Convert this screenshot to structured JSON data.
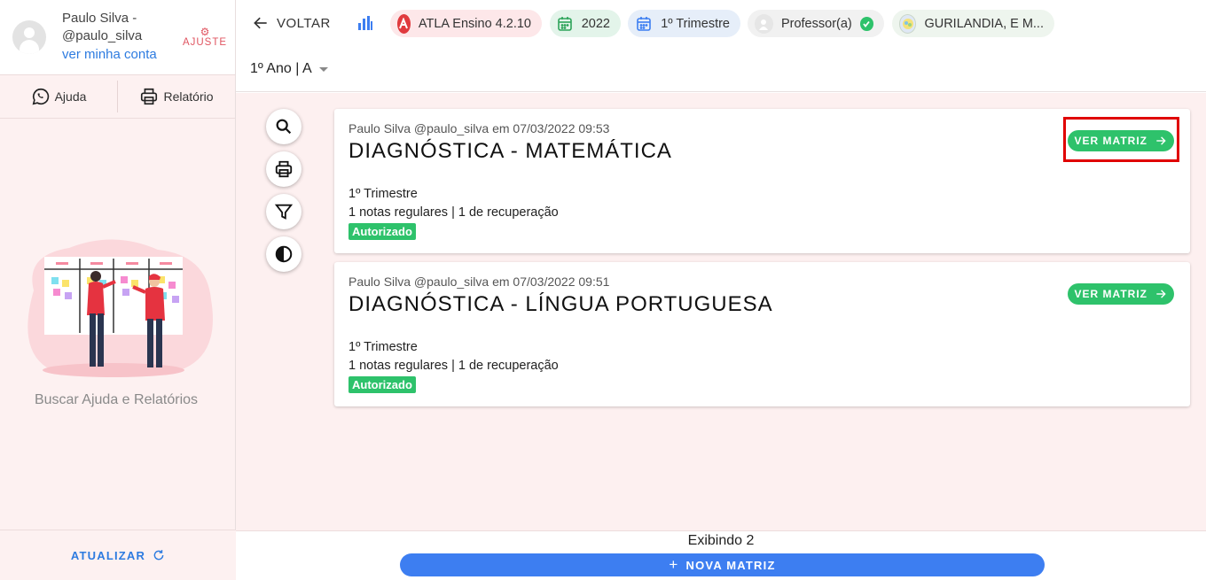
{
  "sidebar": {
    "profile": {
      "name": "Paulo Silva - @paulo_silva",
      "link": "ver minha conta",
      "ajuste_label": "AJUSTE"
    },
    "buttons": [
      {
        "label": "Ajuda",
        "icon": "whatsapp-icon"
      },
      {
        "label": "Relatório",
        "icon": "printer-icon"
      }
    ],
    "help_text": "Buscar Ajuda e Relatórios",
    "footer": {
      "label": "ATUALIZAR",
      "icon": "refresh-icon"
    }
  },
  "topbar": {
    "back_label": "VOLTAR",
    "chips": {
      "app": "ATLA Ensino 4.2.10",
      "year": "2022",
      "term": "1º Trimestre",
      "role": "Professor(a)",
      "school": "GURILANDIA, E M..."
    },
    "class_select": "1º Ano | A"
  },
  "tools": [
    "search-icon",
    "printer-icon",
    "filter-icon",
    "contrast-icon"
  ],
  "cards": [
    {
      "meta": "Paulo Silva @paulo_silva em 07/03/2022 09:53",
      "title": "DIAGNÓSTICA - MATEMÁTICA",
      "term": "1º Trimestre",
      "notes": "1 notas regulares | 1 de recuperação",
      "status": "Autorizado",
      "action": "VER MATRIZ"
    },
    {
      "meta": "Paulo Silva @paulo_silva em 07/03/2022 09:51",
      "title": "DIAGNÓSTICA - LÍNGUA PORTUGUESA",
      "term": "1º Trimestre",
      "notes": "1 notas regulares | 1 de recuperação",
      "status": "Autorizado",
      "action": "VER MATRIZ"
    }
  ],
  "footer": {
    "count_text": "Exibindo 2",
    "new_button": "NOVA MATRIZ"
  },
  "colors": {
    "accent_blue": "#3d7ef1",
    "success_green": "#2ec26b",
    "brand_red": "#e03a3e",
    "highlight_red": "#e00000",
    "sidebar_bg": "#fdf1f1"
  }
}
